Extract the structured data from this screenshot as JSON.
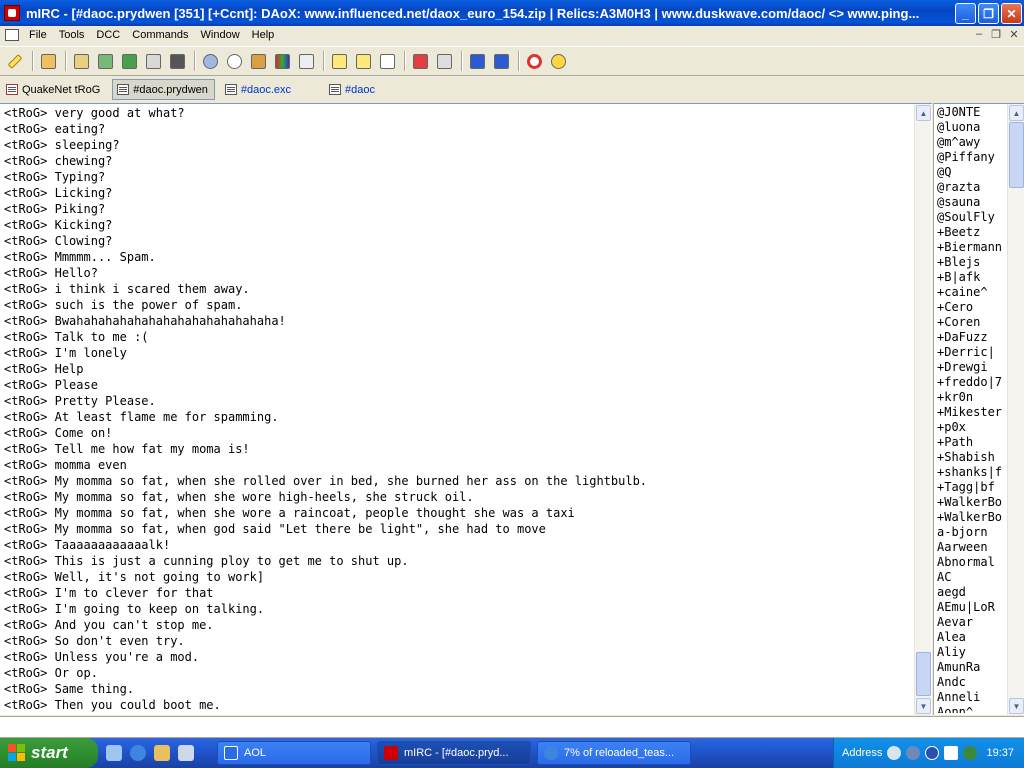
{
  "window": {
    "title": "mIRC - [#daoc.prydwen [351] [+Ccnt]: DAoX: www.influenced.net/daox_euro_154.zip | Relics:A3M0H3 | www.duskwave.com/daoc/ <> www.ping..."
  },
  "menu": [
    "File",
    "Tools",
    "DCC",
    "Commands",
    "Window",
    "Help"
  ],
  "toolbar_icons": [
    "connect-icon",
    "options-icon",
    "alias-icon",
    "scripts-icon",
    "address-book-icon",
    "channels-icon",
    "notify-icon",
    "url-list-icon",
    "dcc-send-icon",
    "dcc-chat-icon",
    "timer-icon",
    "colors-icon",
    "notepad-icon",
    "log-icon",
    "highlight-icon",
    "received-icon",
    "find-icon",
    "ignore-icon",
    "tile-icon",
    "cascade-icon",
    "help-icon",
    "about-icon"
  ],
  "switchbar": {
    "tabs": [
      {
        "label": "QuakeNet tRoG",
        "active": false,
        "color": "#000000"
      },
      {
        "label": "#daoc.prydwen",
        "active": true,
        "color": "#000000"
      },
      {
        "label": "#daoc.exc",
        "active": false,
        "color": "#0033cc"
      },
      {
        "label": "#daoc",
        "active": false,
        "color": "#0033cc"
      }
    ]
  },
  "chat": {
    "nick": "<tRoG>",
    "lines": [
      "very good at what?",
      "eating?",
      "sleeping?",
      "chewing?",
      "Typing?",
      "Licking?",
      "Piking?",
      "Kicking?",
      "Clowing?",
      "Mmmmm... Spam.",
      "Hello?",
      "i think i scared them away.",
      "such is the power of spam.",
      "Bwahahahahahahahahahahahahahaha!",
      "Talk to me :(",
      "I'm lonely",
      "Help",
      "Please",
      "Pretty Please.",
      "At least flame me for spamming.",
      "Come on!",
      "Tell me how fat my moma is!",
      "momma even",
      "My momma so fat, when she rolled over in bed, she burned her ass on the lightbulb.",
      "My momma so fat, when she wore high-heels, she struck oil.",
      "My momma so fat, when she wore a raincoat, people thought she was a taxi",
      "My momma so fat, when god said \"Let there be light\", she had to move",
      "Taaaaaaaaaaaalk!",
      "This is just a cunning ploy to get me to shut up.",
      "Well, it's not going to work]",
      "I'm to clever for that",
      "I'm going to keep on talking.",
      "And you can't stop me.",
      "So don't even try.",
      "Unless you're a mod.",
      "Or op.",
      "Same thing.",
      "Then you could boot me."
    ]
  },
  "nicklist": [
    "@J0NTE",
    "@luona",
    "@m^awy",
    "@Piffany",
    "@Q",
    "@razta",
    "@sauna",
    "@SoulFly",
    "+Beetz",
    "+Biermann",
    "+Blejs",
    "+B|afk",
    "+caine^",
    "+Cero",
    "+Coren",
    "+DaFuzz",
    "+Derric|",
    "+Drewgi",
    "+freddo|7",
    "+kr0n",
    "+Mikester",
    "+p0x",
    "+Path",
    "+Shabish",
    "+shanks|f",
    "+Tagg|bf",
    "+WalkerBo",
    "+WalkerBo",
    "a-bjorn",
    "Aarween",
    "Abnormal",
    "AC",
    "aegd",
    "AEmu|LoR",
    "Aevar",
    "Alea",
    "Aliy",
    "AmunRa",
    "Andc",
    "Anneli",
    "Aonn^"
  ],
  "input": {
    "value": ""
  },
  "taskbar": {
    "start_label": "start",
    "tasks": [
      {
        "label": "AOL",
        "active": false
      },
      {
        "label": "mIRC - [#daoc.pryd...",
        "active": true
      },
      {
        "label": "7% of reloaded_teas...",
        "active": false
      }
    ],
    "address_label": "Address",
    "clock": "19:37"
  }
}
